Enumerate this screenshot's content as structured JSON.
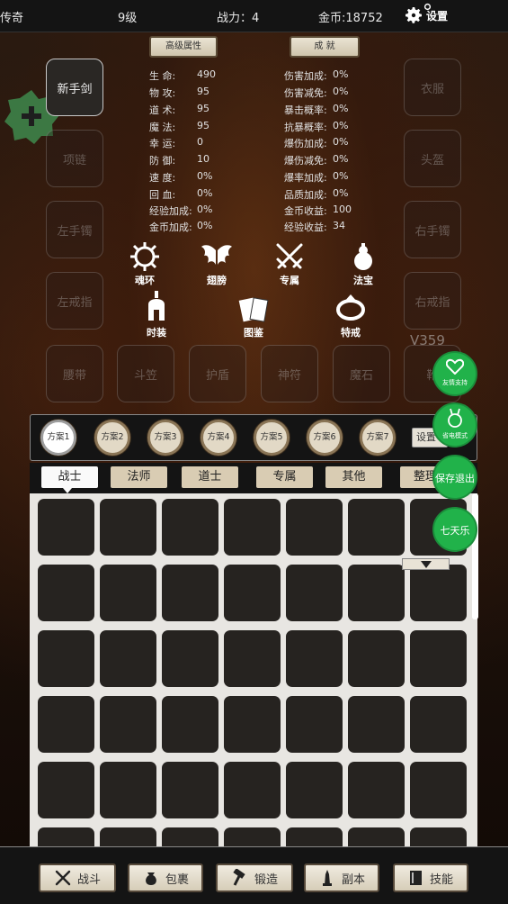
{
  "topbar": {
    "title": "传奇",
    "level": "9级",
    "power": "战力：4",
    "gold": "金币:18752",
    "settings_label": "设置"
  },
  "header_buttons": {
    "advanced": "高级属性",
    "achievement": "成  就"
  },
  "slots_left": [
    "新手剑",
    "项链",
    "左手镯",
    "左戒指"
  ],
  "slots_right": [
    "衣服",
    "头盔",
    "右手镯",
    "右戒指"
  ],
  "slots_bottom": [
    "腰带",
    "斗笠",
    "护盾",
    "神符",
    "魔石",
    "靴"
  ],
  "stats_left": [
    {
      "k": "生    命:",
      "v": "490"
    },
    {
      "k": "物    攻:",
      "v": "95"
    },
    {
      "k": "道    术:",
      "v": "95"
    },
    {
      "k": "魔    法:",
      "v": "95"
    },
    {
      "k": "幸    运:",
      "v": "0"
    },
    {
      "k": "防    御:",
      "v": "10"
    },
    {
      "k": "速    度:",
      "v": "0%"
    },
    {
      "k": "回    血:",
      "v": "0%"
    },
    {
      "k": "经验加成:",
      "v": "0%"
    },
    {
      "k": "金币加成:",
      "v": "0%"
    }
  ],
  "stats_right": [
    {
      "k": "伤害加成:",
      "v": "0%"
    },
    {
      "k": "伤害减免:",
      "v": "0%"
    },
    {
      "k": "暴击概率:",
      "v": "0%"
    },
    {
      "k": "抗暴概率:",
      "v": "0%"
    },
    {
      "k": "爆伤加成:",
      "v": "0%"
    },
    {
      "k": "爆伤减免:",
      "v": "0%"
    },
    {
      "k": "爆率加成:",
      "v": "0%"
    },
    {
      "k": "品质加成:",
      "v": "0%"
    },
    {
      "k": "金币收益:",
      "v": "100"
    },
    {
      "k": "经验收益:",
      "v": "34"
    }
  ],
  "categories": [
    "魂环",
    "翅膀",
    "专属",
    "法宝",
    "时装",
    "图鉴",
    "特戒"
  ],
  "version": "V359",
  "plans": [
    "方案1",
    "方案2",
    "方案3",
    "方案4",
    "方案5",
    "方案6",
    "方案7"
  ],
  "plan_set_label": "设置",
  "tabs": [
    "战士",
    "法师",
    "道士",
    "专属",
    "其他"
  ],
  "sort_label": "整理",
  "fabs": [
    "友情支持",
    "省电模式",
    "保存退出",
    "七天乐"
  ],
  "bottom_nav": [
    "战斗",
    "包裹",
    "锻造",
    "副本",
    "技能"
  ]
}
